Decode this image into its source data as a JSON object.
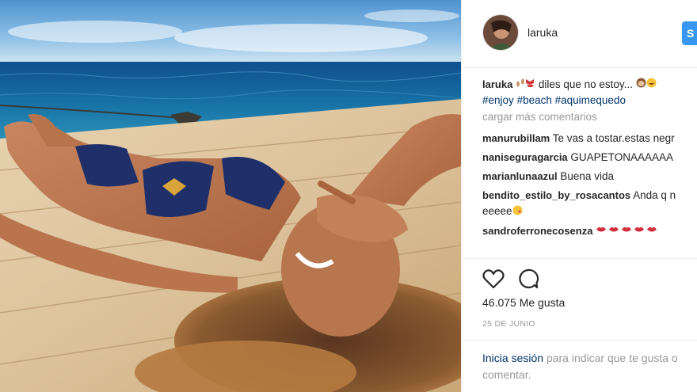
{
  "post": {
    "username": "laruka",
    "follow_label": "S"
  },
  "caption": {
    "user": "laruka",
    "text": "diles que no estoy...",
    "hashtags": [
      "#enjoy",
      "#beach",
      "#aquimequedo"
    ]
  },
  "load_more_label": "cargar más comentarios",
  "comments": [
    {
      "user": "manurubillam",
      "text": "Te vas a tostar.estas negr"
    },
    {
      "user": "naniseguragarcia",
      "text": "GUAPETONAAAAAA"
    },
    {
      "user": "marianlunaazul",
      "text": "Buena vida"
    },
    {
      "user": "bendito_estilo_by_rosacantos",
      "text": "Anda q n",
      "text_continued": "eeeee"
    },
    {
      "user": "sandroferronecosenza",
      "text": ""
    }
  ],
  "likes": "46.075 Me gusta",
  "date": "25 DE JUNIO",
  "login_prompt": {
    "link": "Inicia sesión",
    "text": "para indicar que te gusta o",
    "text_continued": "comentar."
  },
  "icons": {
    "like": "heart-icon",
    "comment": "comment-bubble-icon"
  },
  "colors": {
    "link": "#003569",
    "follow": "#3897f0",
    "muted": "#999999"
  }
}
